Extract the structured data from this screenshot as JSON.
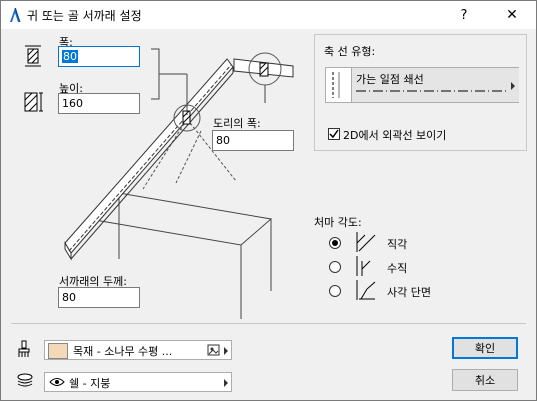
{
  "window": {
    "title": "귀 또는 골 서까래 설정",
    "help": "?",
    "close": "✕"
  },
  "params": {
    "width_label": "폭:",
    "width_value": "80",
    "height_label": "높이:",
    "height_value": "160",
    "ridge_width_label": "도리의 폭:",
    "ridge_width_value": "80",
    "thickness_label": "서까래의 두께:",
    "thickness_value": "80"
  },
  "axis_line": {
    "group_label": "축 선 유형:",
    "line_type": "가는 일점 쇄선",
    "checkbox_label": "2D에서 외곽선 보이기",
    "checkbox_checked": true
  },
  "eave_angle": {
    "label": "처마 각도:",
    "options": [
      {
        "label": "직각",
        "selected": true
      },
      {
        "label": "수직",
        "selected": false
      },
      {
        "label": "사각 단면",
        "selected": false
      }
    ]
  },
  "footer": {
    "material": "목재 - 소나무 수평 ...",
    "layer": "쉘 - 지붕",
    "ok": "확인",
    "cancel": "취소"
  },
  "colors": {
    "accent": "#0078d7",
    "material_swatch": "#f3d9b8"
  }
}
